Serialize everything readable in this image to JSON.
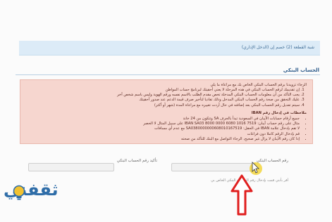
{
  "top_bar": {
    "text": "شبة القطعة (2) خصم إن (الدخل الإداري)"
  },
  "section": {
    "title": "الحساب البنكي"
  },
  "notice": {
    "intro": "الرجاء تزويدنا برقم الحساب البنكي الخاص بك مع مراعاة ما يلي",
    "items": [
      "إن تقديمك لرقم الحساب البنكي في هذه المرحلة لا يعني أحقيتك لبرنامج حساب المواطن",
      "يجب التأكد من أن معلومات الحساب البنكي المدخلة تخص مقدم الطلب بالاسم نفسه ورقم الهوية وليس باسم شخص آخر",
      "عليك التحقق من صحة رقم الحساب البنكي المدخل وذلك تفاديا لتأخير صرف قيمة الدعم عند صدور أحقيتك",
      "سيتم تعديل رقم الحساب البنكي بعد إضافته في حال أردت تغييره مع مراعاة المدة (شهر أو أكثر)"
    ],
    "notes_title": "ملاحظات في إدخال رقم IBAN",
    "notes": [
      "جميع أرقام حسابات الآيبان في السعودية تبدأ بالحرف SA وتتكون من 24 خانة",
      "مثال على رقم حساب آيبان: IBAN SA03 8000 0000 6080 1016 7519 على سبيل المثال لا الحصر",
      "لا تقم بإدخال علامة IBAN في الحقل: SA0380000000608010167519 مع عدم أي مسافات",
      "قم بإدخال الرقم كاملا دون فراغات",
      "إذا كان رقم الآيبان لا يزال غير صحيح، الرجاء التواصل مع البنك للتأكد من صحته"
    ]
  },
  "form": {
    "iban_label": "رقم الحساب البنكي",
    "iban_value": "",
    "confirm_label": "تأكيد رقم الحساب البنكي",
    "confirm_value": ""
  },
  "footer_note": "أقر بأنني قمت بإدخال رقم الحساب البنكي الخاص بي",
  "logo": {
    "text": "ثقفني"
  },
  "colors": {
    "arrow": "#e01f1f",
    "cursor": "#f2d024",
    "brand": "#2f6da8"
  }
}
